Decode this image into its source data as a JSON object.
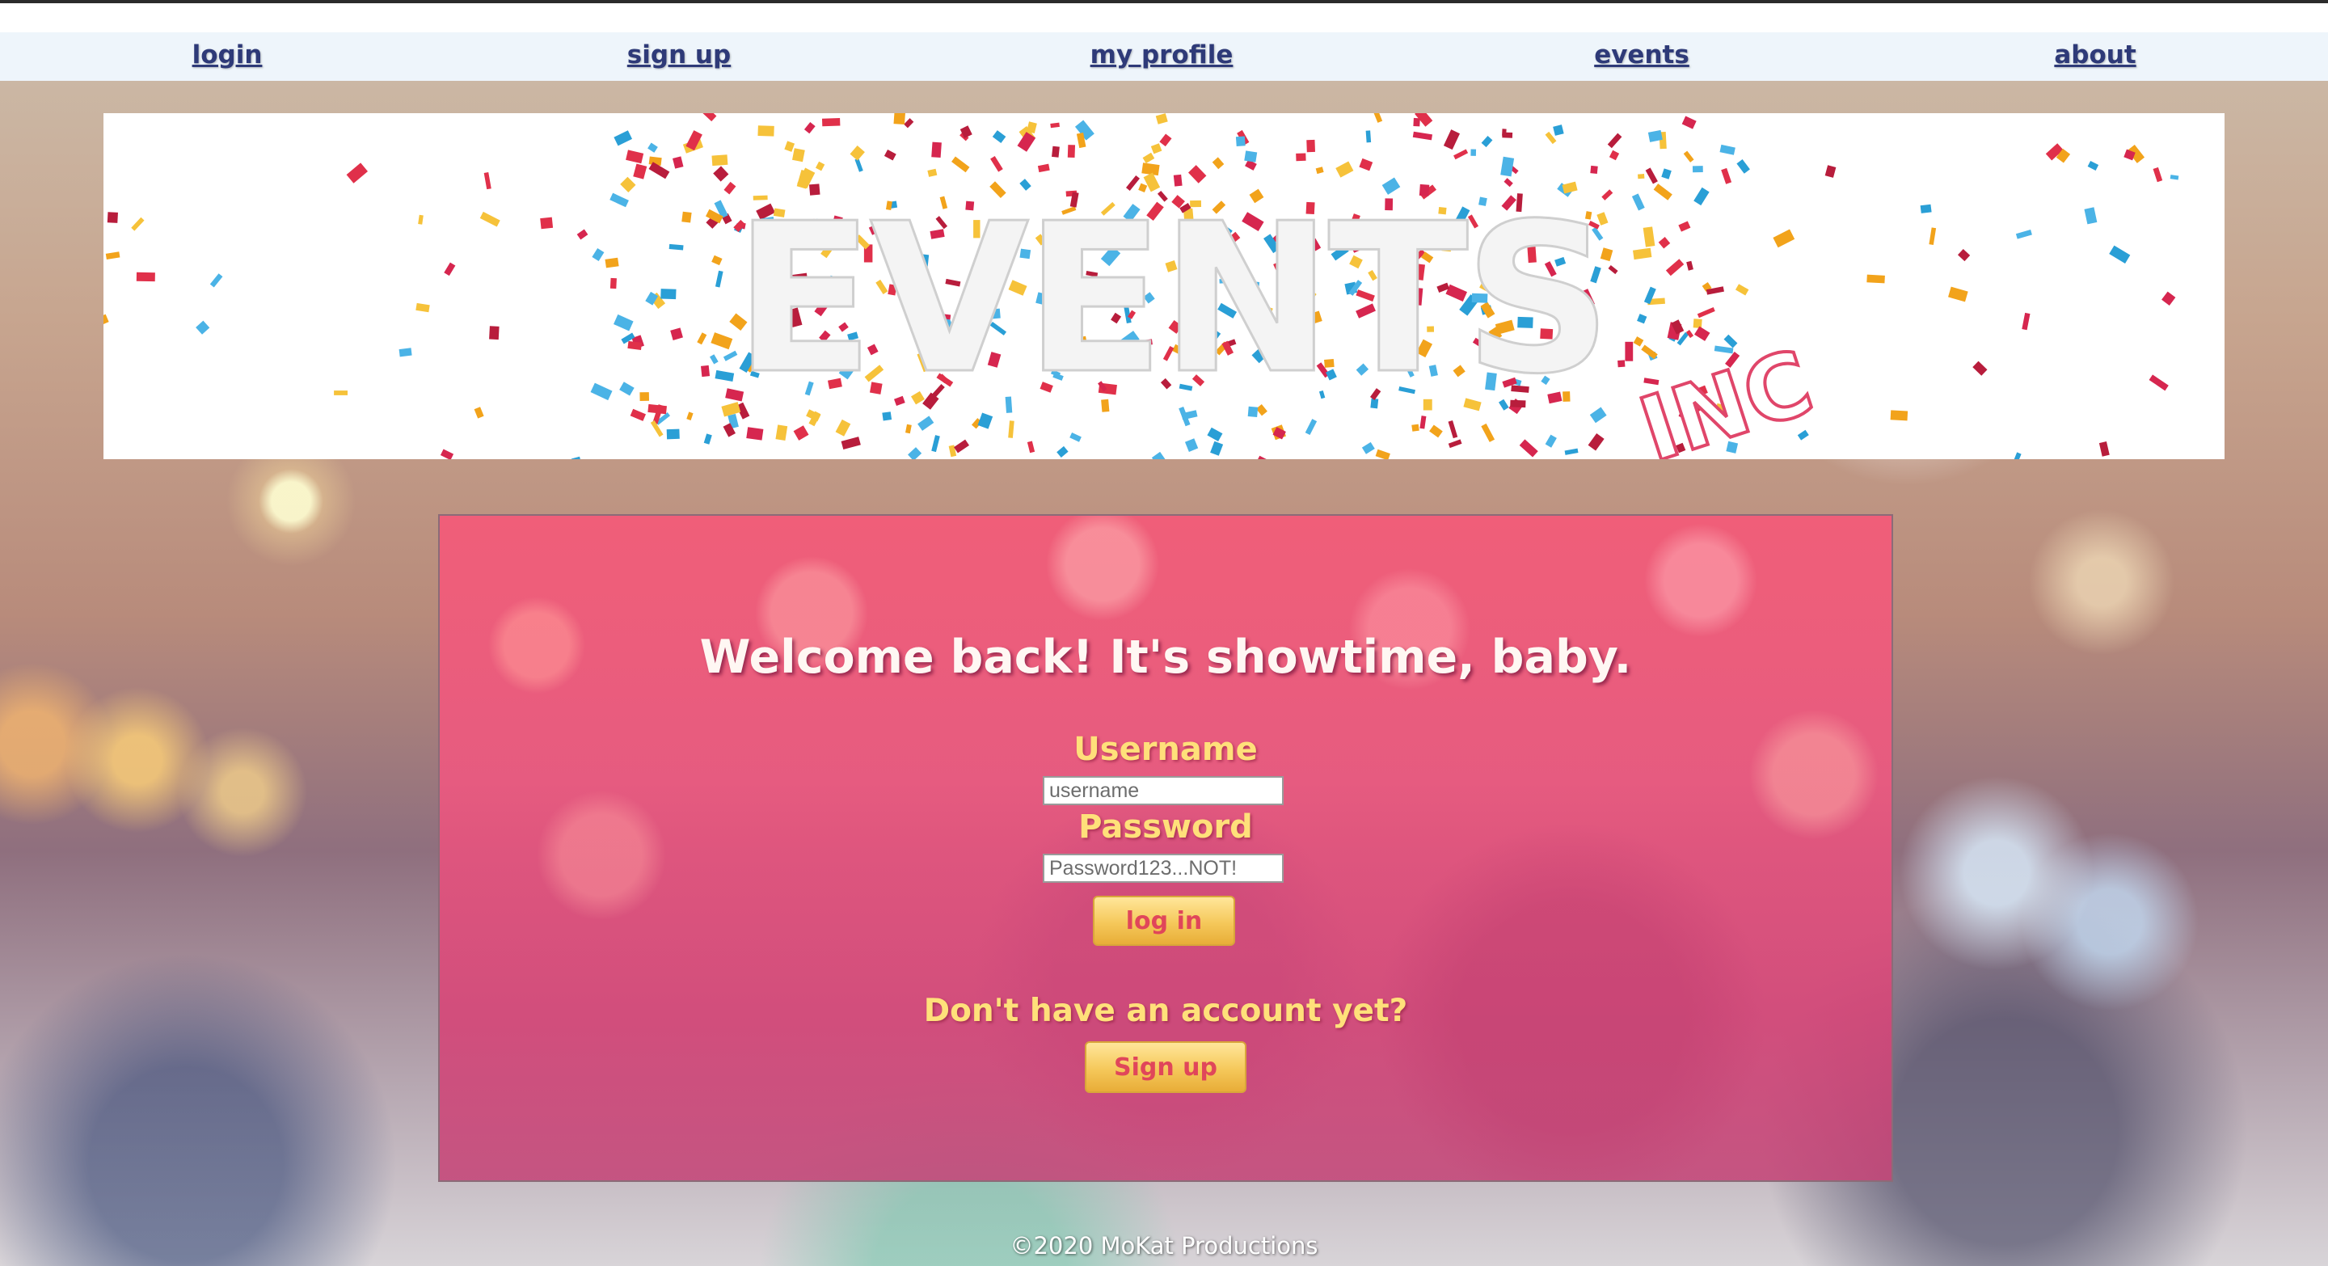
{
  "nav": {
    "items": [
      {
        "label": "login"
      },
      {
        "label": "sign up"
      },
      {
        "label": "my profile"
      },
      {
        "label": "events"
      },
      {
        "label": "about"
      }
    ]
  },
  "banner": {
    "logo_main": "EVENTS",
    "logo_sub": "INC"
  },
  "login": {
    "heading": "Welcome back! It's showtime, baby.",
    "username_label": "Username",
    "username_placeholder": "username",
    "password_label": "Password",
    "password_placeholder": "Password123...NOT!",
    "login_button": "log in",
    "no_account_text": "Don't have an account yet?",
    "signup_button": "Sign up"
  },
  "footer": {
    "copyright": "©2020 MoKat Productions"
  },
  "colors": {
    "nav_link": "#2e3a78",
    "label_gold": "#ffe07a",
    "button_text": "#e0465a",
    "panel_pink": "#ee5880"
  }
}
